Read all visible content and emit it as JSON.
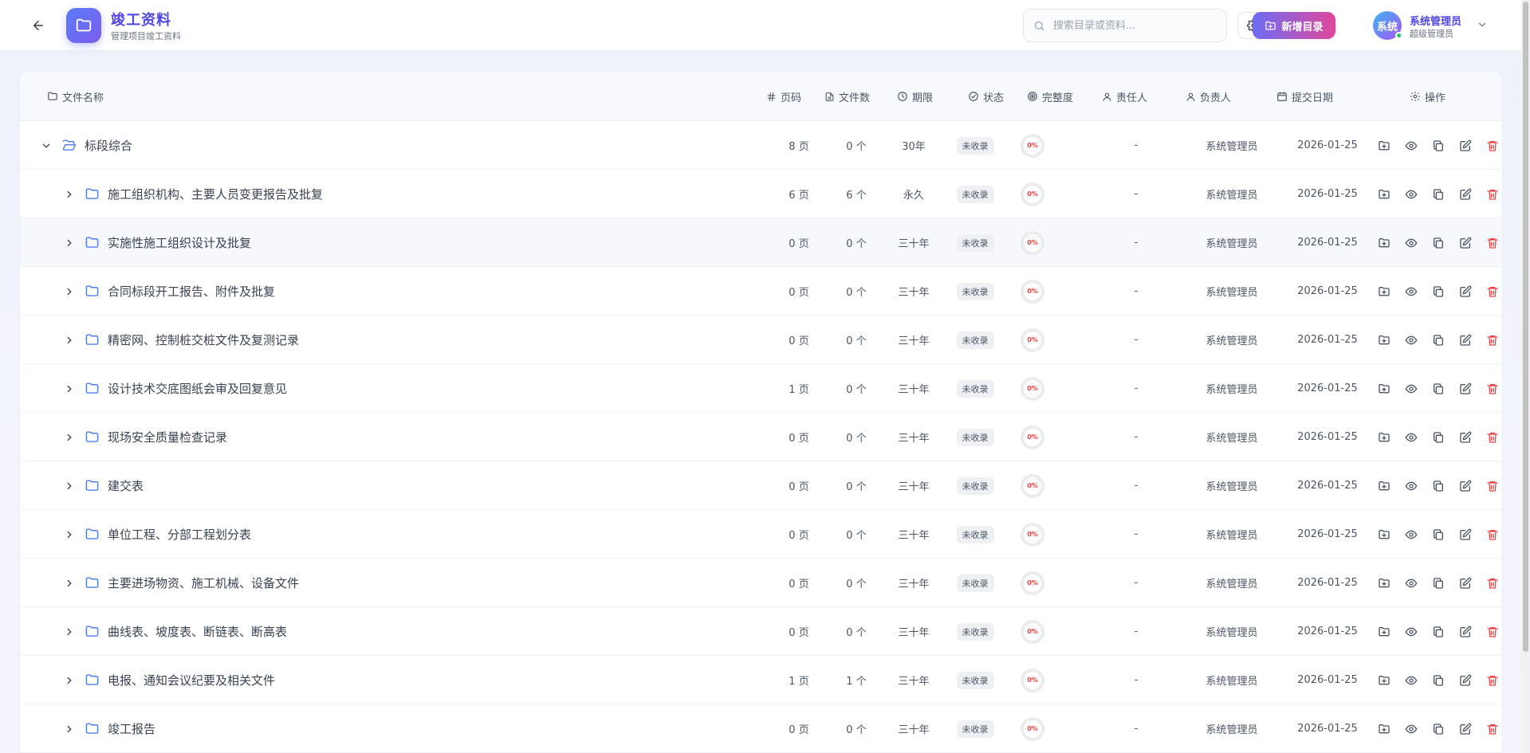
{
  "header": {
    "title": "竣工资料",
    "subtitle": "管理项目竣工资料",
    "search_placeholder": "搜索目录或资料...",
    "new_button": "新增目录",
    "user_name": "系统管理员",
    "user_role": "超级管理员",
    "avatar_text": "系统"
  },
  "table": {
    "columns": {
      "name": "文件名称",
      "pages": "页码",
      "files": "文件数",
      "period": "期限",
      "status": "状态",
      "completeness": "完整度",
      "responsible": "责任人",
      "owner": "负责人",
      "date": "提交日期",
      "ops": "操作"
    },
    "rows": [
      {
        "name": "标段综合",
        "pages": "8 页",
        "files": "0 个",
        "period": "30年",
        "status": "未收录",
        "completeness": "0%",
        "responsible": "-",
        "owner": "系统管理员",
        "date": "2026-01-25"
      },
      {
        "name": "施工组织机构、主要人员变更报告及批复",
        "pages": "6 页",
        "files": "6 个",
        "period": "永久",
        "status": "未收录",
        "completeness": "0%",
        "responsible": "-",
        "owner": "系统管理员",
        "date": "2026-01-25"
      },
      {
        "name": "实施性施工组织设计及批复",
        "pages": "0 页",
        "files": "0 个",
        "period": "三十年",
        "status": "未收录",
        "completeness": "0%",
        "responsible": "-",
        "owner": "系统管理员",
        "date": "2026-01-25"
      },
      {
        "name": "合同标段开工报告、附件及批复",
        "pages": "0 页",
        "files": "0 个",
        "period": "三十年",
        "status": "未收录",
        "completeness": "0%",
        "responsible": "-",
        "owner": "系统管理员",
        "date": "2026-01-25"
      },
      {
        "name": "精密网、控制桩交桩文件及复测记录",
        "pages": "0 页",
        "files": "0 个",
        "period": "三十年",
        "status": "未收录",
        "completeness": "0%",
        "responsible": "-",
        "owner": "系统管理员",
        "date": "2026-01-25"
      },
      {
        "name": "设计技术交底图纸会审及回复意见",
        "pages": "1 页",
        "files": "0 个",
        "period": "三十年",
        "status": "未收录",
        "completeness": "0%",
        "responsible": "-",
        "owner": "系统管理员",
        "date": "2026-01-25"
      },
      {
        "name": "现场安全质量检查记录",
        "pages": "0 页",
        "files": "0 个",
        "period": "三十年",
        "status": "未收录",
        "completeness": "0%",
        "responsible": "-",
        "owner": "系统管理员",
        "date": "2026-01-25"
      },
      {
        "name": "建交表",
        "pages": "0 页",
        "files": "0 个",
        "period": "三十年",
        "status": "未收录",
        "completeness": "0%",
        "responsible": "-",
        "owner": "系统管理员",
        "date": "2026-01-25"
      },
      {
        "name": "单位工程、分部工程划分表",
        "pages": "0 页",
        "files": "0 个",
        "period": "三十年",
        "status": "未收录",
        "completeness": "0%",
        "responsible": "-",
        "owner": "系统管理员",
        "date": "2026-01-25"
      },
      {
        "name": "主要进场物资、施工机械、设备文件",
        "pages": "0 页",
        "files": "0 个",
        "period": "三十年",
        "status": "未收录",
        "completeness": "0%",
        "responsible": "-",
        "owner": "系统管理员",
        "date": "2026-01-25"
      },
      {
        "name": "曲线表、坡度表、断链表、断高表",
        "pages": "0 页",
        "files": "0 个",
        "period": "三十年",
        "status": "未收录",
        "completeness": "0%",
        "responsible": "-",
        "owner": "系统管理员",
        "date": "2026-01-25"
      },
      {
        "name": "电报、通知会议纪要及相关文件",
        "pages": "1 页",
        "files": "1 个",
        "period": "三十年",
        "status": "未收录",
        "completeness": "0%",
        "responsible": "-",
        "owner": "系统管理员",
        "date": "2026-01-25"
      },
      {
        "name": "竣工报告",
        "pages": "0 页",
        "files": "0 个",
        "period": "三十年",
        "status": "未收录",
        "completeness": "0%",
        "responsible": "-",
        "owner": "系统管理员",
        "date": "2026-01-25"
      }
    ]
  },
  "colors": {
    "accent": "#4f46e5",
    "folder": "#4f7df0",
    "danger": "#ef4444"
  },
  "icons": [
    "back-arrow-icon",
    "folder-icon",
    "search-icon",
    "gear-icon",
    "folder-plus-icon",
    "chevron-down-icon",
    "chevron-right-icon",
    "hash-icon",
    "file-icon",
    "clock-icon",
    "check-circle-icon",
    "target-icon",
    "user-icon",
    "calendar-icon",
    "eye-icon",
    "copy-icon",
    "edit-icon",
    "trash-icon"
  ]
}
